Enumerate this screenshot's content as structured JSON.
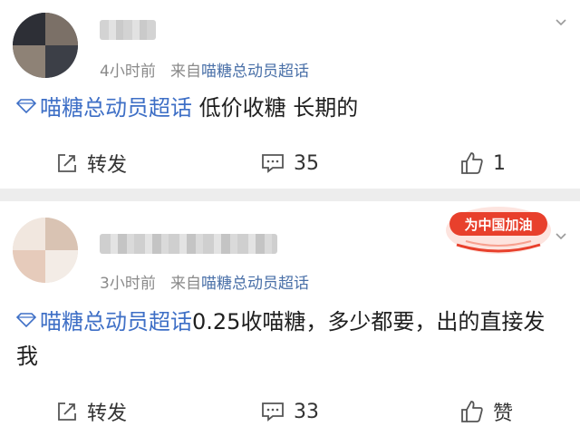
{
  "posts": [
    {
      "time": "4小时前",
      "source_prefix": "来自",
      "source": "喵糖总动员超话",
      "topic": "喵糖总动员超话",
      "text": " 低价收糖 长期的",
      "repost_label": "转发",
      "comment_count": "35",
      "like_label": "1"
    },
    {
      "time": "3小时前",
      "source_prefix": "来自",
      "source": "喵糖总动员超话",
      "topic": "喵糖总动员超话",
      "text": "0.25收喵糖，多少都要，出的直接发我",
      "repost_label": "转发",
      "comment_count": "33",
      "like_label": "赞",
      "badge_text": "为中国加油"
    }
  ],
  "colors": {
    "topic": "#3e6fc6",
    "source": "#4a70a8",
    "meta": "#8a8a8a",
    "badge": "#e8402c"
  }
}
